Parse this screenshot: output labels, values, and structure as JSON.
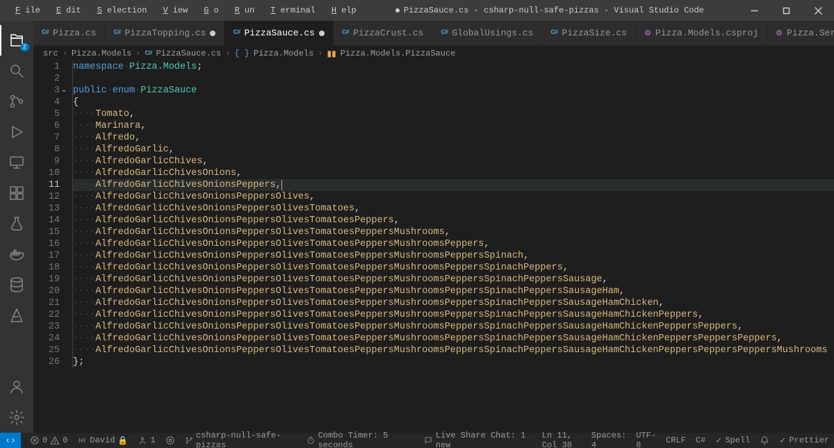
{
  "title": "PizzaSauce.cs - csharp-null-safe-pizzas - Visual Studio Code",
  "title_modified": true,
  "menu": [
    "File",
    "Edit",
    "Selection",
    "View",
    "Go",
    "Run",
    "Terminal",
    "Help"
  ],
  "activitybar": {
    "explorer_badge": "2"
  },
  "tabs": [
    {
      "label": "Pizza.cs",
      "icon": "cs",
      "modified": false,
      "active": false
    },
    {
      "label": "PizzaTopping.cs",
      "icon": "cs",
      "modified": true,
      "active": false
    },
    {
      "label": "PizzaSauce.cs",
      "icon": "cs",
      "modified": true,
      "active": true
    },
    {
      "label": "PizzaCrust.cs",
      "icon": "cs",
      "modified": false,
      "active": false
    },
    {
      "label": "GlobalUsings.cs",
      "icon": "cs",
      "modified": false,
      "active": false
    },
    {
      "label": "PizzaSize.cs",
      "icon": "cs",
      "modified": false,
      "active": false
    },
    {
      "label": "Pizza.Models.csproj",
      "icon": "csproj",
      "modified": false,
      "active": false
    },
    {
      "label": "Pizza.Service.csproj",
      "icon": "csproj",
      "modified": false,
      "active": false
    }
  ],
  "breadcrumb": {
    "items": [
      "src",
      "Pizza.Models",
      "PizzaSauce.cs",
      "Pizza.Models",
      "Pizza.Models.PizzaSauce"
    ],
    "icons": [
      "",
      "",
      "cs",
      "brackets",
      "enum"
    ]
  },
  "code": {
    "current_line": 11,
    "lines": [
      {
        "n": 1,
        "raw": [
          [
            "kw",
            "namespace"
          ],
          [
            "ws",
            "·"
          ],
          [
            "type",
            "Pizza.Models"
          ],
          [
            "punct",
            ";"
          ]
        ]
      },
      {
        "n": 2,
        "raw": []
      },
      {
        "n": 3,
        "raw": [
          [
            "kw",
            "public"
          ],
          [
            "ws",
            "·"
          ],
          [
            "kw",
            "enum"
          ],
          [
            "ws",
            "·"
          ],
          [
            "type",
            "PizzaSauce"
          ]
        ]
      },
      {
        "n": 4,
        "raw": [
          [
            "punct",
            "{"
          ]
        ]
      },
      {
        "n": 5,
        "raw": [
          [
            "ws",
            "····"
          ],
          [
            "enum",
            "Tomato"
          ],
          [
            "punct",
            ","
          ]
        ]
      },
      {
        "n": 6,
        "raw": [
          [
            "ws",
            "····"
          ],
          [
            "enum",
            "Marinara"
          ],
          [
            "punct",
            ","
          ]
        ]
      },
      {
        "n": 7,
        "raw": [
          [
            "ws",
            "····"
          ],
          [
            "enum",
            "Alfredo"
          ],
          [
            "punct",
            ","
          ]
        ]
      },
      {
        "n": 8,
        "raw": [
          [
            "ws",
            "····"
          ],
          [
            "enum",
            "AlfredoGarlic"
          ],
          [
            "punct",
            ","
          ]
        ]
      },
      {
        "n": 9,
        "raw": [
          [
            "ws",
            "····"
          ],
          [
            "enum",
            "AlfredoGarlicChives"
          ],
          [
            "punct",
            ","
          ]
        ]
      },
      {
        "n": 10,
        "raw": [
          [
            "ws",
            "····"
          ],
          [
            "enum",
            "AlfredoGarlicChivesOnions"
          ],
          [
            "punct",
            ","
          ]
        ]
      },
      {
        "n": 11,
        "raw": [
          [
            "ws",
            "····"
          ],
          [
            "enum",
            "AlfredoGarlicChivesOnionsPeppers"
          ],
          [
            "punct",
            ","
          ]
        ]
      },
      {
        "n": 12,
        "raw": [
          [
            "ws",
            "····"
          ],
          [
            "enum",
            "AlfredoGarlicChivesOnionsPeppersOlives"
          ],
          [
            "punct",
            ","
          ]
        ]
      },
      {
        "n": 13,
        "raw": [
          [
            "ws",
            "····"
          ],
          [
            "enum",
            "AlfredoGarlicChivesOnionsPeppersOlivesTomatoes"
          ],
          [
            "punct",
            ","
          ]
        ]
      },
      {
        "n": 14,
        "raw": [
          [
            "ws",
            "····"
          ],
          [
            "enum",
            "AlfredoGarlicChivesOnionsPeppersOlivesTomatoesPeppers"
          ],
          [
            "punct",
            ","
          ]
        ]
      },
      {
        "n": 15,
        "raw": [
          [
            "ws",
            "····"
          ],
          [
            "enum",
            "AlfredoGarlicChivesOnionsPeppersOlivesTomatoesPeppersMushrooms"
          ],
          [
            "punct",
            ","
          ]
        ]
      },
      {
        "n": 16,
        "raw": [
          [
            "ws",
            "····"
          ],
          [
            "enum",
            "AlfredoGarlicChivesOnionsPeppersOlivesTomatoesPeppersMushroomsPeppers"
          ],
          [
            "punct",
            ","
          ]
        ]
      },
      {
        "n": 17,
        "raw": [
          [
            "ws",
            "····"
          ],
          [
            "enum",
            "AlfredoGarlicChivesOnionsPeppersOlivesTomatoesPeppersMushroomsPeppersSpinach"
          ],
          [
            "punct",
            ","
          ]
        ]
      },
      {
        "n": 18,
        "raw": [
          [
            "ws",
            "····"
          ],
          [
            "enum",
            "AlfredoGarlicChivesOnionsPeppersOlivesTomatoesPeppersMushroomsPeppersSpinachPeppers"
          ],
          [
            "punct",
            ","
          ]
        ]
      },
      {
        "n": 19,
        "raw": [
          [
            "ws",
            "····"
          ],
          [
            "enum",
            "AlfredoGarlicChivesOnionsPeppersOlivesTomatoesPeppersMushroomsPeppersSpinachPeppersSausage"
          ],
          [
            "punct",
            ","
          ]
        ]
      },
      {
        "n": 20,
        "raw": [
          [
            "ws",
            "····"
          ],
          [
            "enum",
            "AlfredoGarlicChivesOnionsPeppersOlivesTomatoesPeppersMushroomsPeppersSpinachPeppersSausageHam"
          ],
          [
            "punct",
            ","
          ]
        ]
      },
      {
        "n": 21,
        "raw": [
          [
            "ws",
            "····"
          ],
          [
            "enum",
            "AlfredoGarlicChivesOnionsPeppersOlivesTomatoesPeppersMushroomsPeppersSpinachPeppersSausageHamChicken"
          ],
          [
            "punct",
            ","
          ]
        ]
      },
      {
        "n": 22,
        "raw": [
          [
            "ws",
            "····"
          ],
          [
            "enum",
            "AlfredoGarlicChivesOnionsPeppersOlivesTomatoesPeppersMushroomsPeppersSpinachPeppersSausageHamChickenPeppers"
          ],
          [
            "punct",
            ","
          ]
        ]
      },
      {
        "n": 23,
        "raw": [
          [
            "ws",
            "····"
          ],
          [
            "enum",
            "AlfredoGarlicChivesOnionsPeppersOlivesTomatoesPeppersMushroomsPeppersSpinachPeppersSausageHamChickenPeppersPeppers"
          ],
          [
            "punct",
            ","
          ]
        ]
      },
      {
        "n": 24,
        "raw": [
          [
            "ws",
            "····"
          ],
          [
            "enum",
            "AlfredoGarlicChivesOnionsPeppersOlivesTomatoesPeppersMushroomsPeppersSpinachPeppersSausageHamChickenPeppersPeppersPeppers"
          ],
          [
            "punct",
            ","
          ]
        ]
      },
      {
        "n": 25,
        "raw": [
          [
            "ws",
            "····"
          ],
          [
            "enum",
            "AlfredoGarlicChivesOnionsPeppersOlivesTomatoesPeppersMushroomsPeppersSpinachPeppersSausageHamChickenPeppersPeppersPeppersMushrooms"
          ]
        ]
      },
      {
        "n": 26,
        "raw": [
          [
            "punct",
            "};"
          ]
        ]
      }
    ]
  },
  "statusbar": {
    "errors": "0",
    "warnings": "0",
    "broadcast": "David",
    "people": "1",
    "branch": "csharp-null-safe-pizzas",
    "combo": "Combo Timer: 5 seconds",
    "liveshare": "Live Share Chat: 1 new",
    "pos": "Ln 11, Col 38",
    "spaces": "Spaces: 4",
    "encoding": "UTF-8",
    "eol": "CRLF",
    "lang": "C#",
    "spell": "Spell",
    "bell": "",
    "prettier": "Prettier"
  }
}
